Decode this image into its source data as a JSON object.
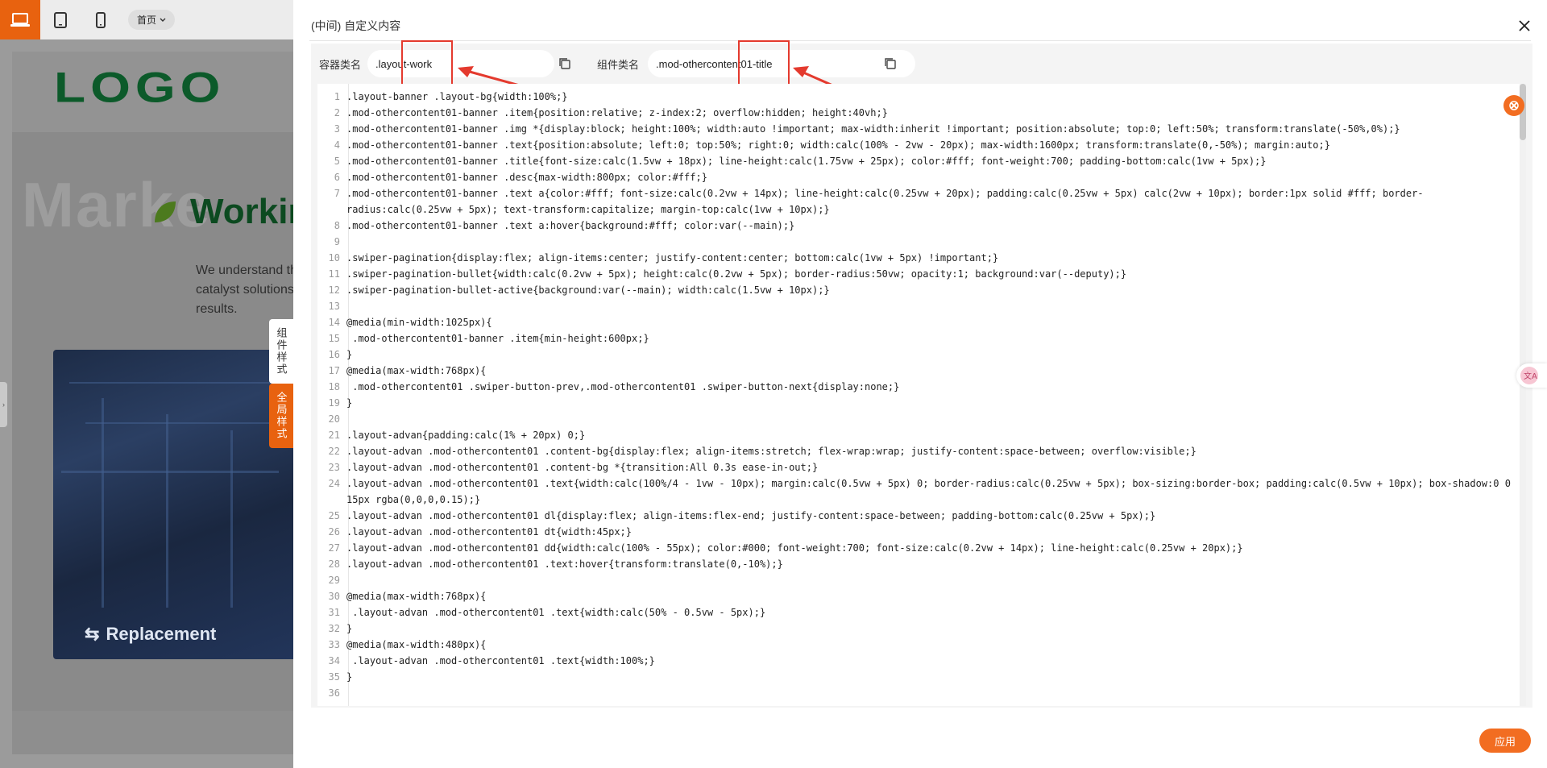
{
  "topbar": {
    "page_select_label": "首页",
    "device_icons": [
      "laptop-icon",
      "tablet-icon",
      "phone-icon"
    ],
    "accent_color": "#e8620f"
  },
  "background_page": {
    "logo": "LOGO",
    "watermark": "Marke",
    "title": "Workin",
    "description": "We understand th catalyst solutions results.",
    "photo_caption": "Replacement"
  },
  "side_tabs": {
    "component_style": "组件样式",
    "global_style": "全局样式"
  },
  "modal": {
    "title": "(中间) 自定义内容",
    "container_label": "容器类名",
    "container_value": ".layout-work",
    "component_label": "组件类名",
    "component_value": ".mod-othercontent01-title",
    "apply_label": "应用",
    "accent_color": "#f26d21",
    "annotation_color": "#e43a2e"
  },
  "code_lines": [
    {
      "n": "1",
      "text": ".layout-banner .layout-bg{width:100%;}"
    },
    {
      "n": "2",
      "text": ".mod-othercontent01-banner .item{position:relative; z-index:2; overflow:hidden; height:40vh;}"
    },
    {
      "n": "3",
      "text": ".mod-othercontent01-banner .img *{display:block; height:100%; width:auto !important; max-width:inherit !important; position:absolute; top:0; left:50%; transform:translate(-50%,0%);}"
    },
    {
      "n": "4",
      "text": ".mod-othercontent01-banner .text{position:absolute; left:0; top:50%; right:0; width:calc(100% - 2vw - 20px); max-width:1600px; transform:translate(0,-50%); margin:auto;}"
    },
    {
      "n": "5",
      "text": ".mod-othercontent01-banner .title{font-size:calc(1.5vw + 18px); line-height:calc(1.75vw + 25px); color:#fff; font-weight:700; padding-bottom:calc(1vw + 5px);}"
    },
    {
      "n": "6",
      "text": ".mod-othercontent01-banner .desc{max-width:800px; color:#fff;}"
    },
    {
      "n": "7",
      "text": ".mod-othercontent01-banner .text a{color:#fff; font-size:calc(0.2vw + 14px); line-height:calc(0.25vw + 20px); padding:calc(0.25vw + 5px) calc(2vw + 10px); border:1px solid #fff; border-"
    },
    {
      "n": "",
      "text": "radius:calc(0.25vw + 5px); text-transform:capitalize; margin-top:calc(1vw + 10px);}"
    },
    {
      "n": "8",
      "text": ".mod-othercontent01-banner .text a:hover{background:#fff; color:var(--main);}"
    },
    {
      "n": "9",
      "text": ""
    },
    {
      "n": "10",
      "text": ".swiper-pagination{display:flex; align-items:center; justify-content:center; bottom:calc(1vw + 5px) !important;}"
    },
    {
      "n": "11",
      "text": ".swiper-pagination-bullet{width:calc(0.2vw + 5px); height:calc(0.2vw + 5px); border-radius:50vw; opacity:1; background:var(--deputy);}"
    },
    {
      "n": "12",
      "text": ".swiper-pagination-bullet-active{background:var(--main); width:calc(1.5vw + 10px);}"
    },
    {
      "n": "13",
      "text": ""
    },
    {
      "n": "14",
      "text": "@media(min-width:1025px){"
    },
    {
      "n": "15",
      "text": " .mod-othercontent01-banner .item{min-height:600px;}"
    },
    {
      "n": "16",
      "text": "}"
    },
    {
      "n": "17",
      "text": "@media(max-width:768px){"
    },
    {
      "n": "18",
      "text": " .mod-othercontent01 .swiper-button-prev,.mod-othercontent01 .swiper-button-next{display:none;}"
    },
    {
      "n": "19",
      "text": "}"
    },
    {
      "n": "20",
      "text": ""
    },
    {
      "n": "21",
      "text": ".layout-advan{padding:calc(1% + 20px) 0;}"
    },
    {
      "n": "22",
      "text": ".layout-advan .mod-othercontent01 .content-bg{display:flex; align-items:stretch; flex-wrap:wrap; justify-content:space-between; overflow:visible;}"
    },
    {
      "n": "23",
      "text": ".layout-advan .mod-othercontent01 .content-bg *{transition:All 0.3s ease-in-out;}"
    },
    {
      "n": "24",
      "text": ".layout-advan .mod-othercontent01 .text{width:calc(100%/4 - 1vw - 10px); margin:calc(0.5vw + 5px) 0; border-radius:calc(0.25vw + 5px); box-sizing:border-box; padding:calc(0.5vw + 10px); box-shadow:0 0"
    },
    {
      "n": "",
      "text": "15px rgba(0,0,0,0.15);}"
    },
    {
      "n": "25",
      "text": ".layout-advan .mod-othercontent01 dl{display:flex; align-items:flex-end; justify-content:space-between; padding-bottom:calc(0.25vw + 5px);}"
    },
    {
      "n": "26",
      "text": ".layout-advan .mod-othercontent01 dt{width:45px;}"
    },
    {
      "n": "27",
      "text": ".layout-advan .mod-othercontent01 dd{width:calc(100% - 55px); color:#000; font-weight:700; font-size:calc(0.2vw + 14px); line-height:calc(0.25vw + 20px);}"
    },
    {
      "n": "28",
      "text": ".layout-advan .mod-othercontent01 .text:hover{transform:translate(0,-10%);}"
    },
    {
      "n": "29",
      "text": ""
    },
    {
      "n": "30",
      "text": "@media(max-width:768px){"
    },
    {
      "n": "31",
      "text": " .layout-advan .mod-othercontent01 .text{width:calc(50% - 0.5vw - 5px);}"
    },
    {
      "n": "32",
      "text": "}"
    },
    {
      "n": "33",
      "text": "@media(max-width:480px){"
    },
    {
      "n": "34",
      "text": " .layout-advan .mod-othercontent01 .text{width:100%;}"
    },
    {
      "n": "35",
      "text": "}"
    },
    {
      "n": "36",
      "text": ""
    }
  ]
}
